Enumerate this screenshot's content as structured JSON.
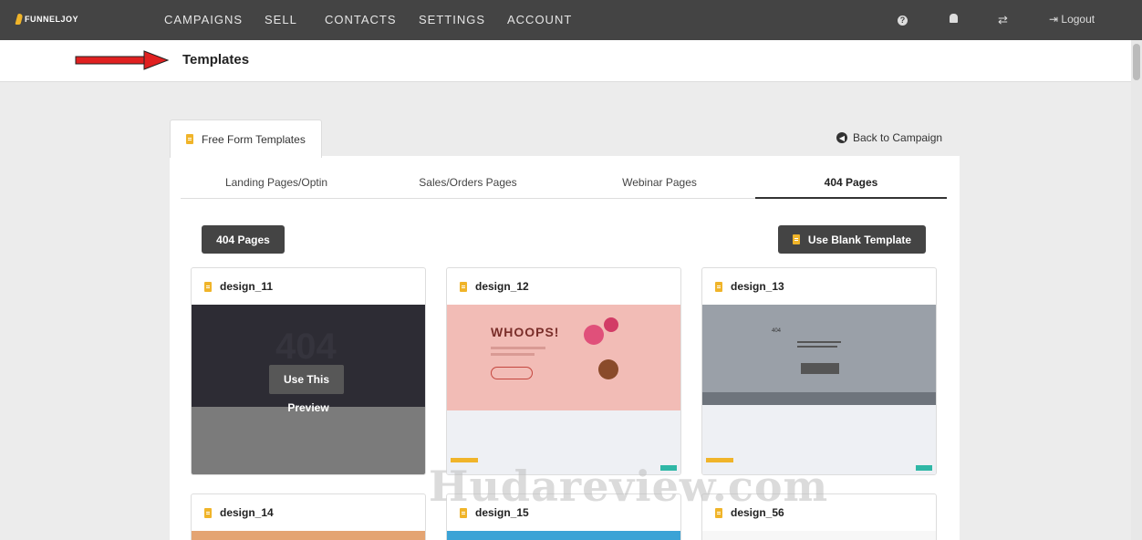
{
  "nav": {
    "brand": "FUNNELJOY",
    "items": [
      "CAMPAIGNS",
      "SELL",
      "CONTACTS",
      "SETTINGS",
      "ACCOUNT"
    ],
    "logout": "Logout"
  },
  "page": {
    "title": "Templates"
  },
  "tabs": {
    "main": "Free Form Templates",
    "back": "Back to Campaign",
    "sub": [
      "Landing Pages/Optin",
      "Sales/Orders Pages",
      "Webinar Pages",
      "404 Pages"
    ]
  },
  "actions": {
    "category": "404 Pages",
    "blank": "Use Blank Template"
  },
  "cards": [
    {
      "name": "design_11",
      "overlay_use": "Use This",
      "overlay_preview": "Preview",
      "thumb_text": "404"
    },
    {
      "name": "design_12",
      "thumb_text": "WHOOPS!"
    },
    {
      "name": "design_13",
      "thumb_text": "404"
    },
    {
      "name": "design_14"
    },
    {
      "name": "design_15"
    },
    {
      "name": "design_56"
    }
  ],
  "watermark": "Hudareview.com",
  "colors": {
    "nav_bg": "#444444",
    "accent": "#f0b429",
    "arrow": "#e02020"
  }
}
